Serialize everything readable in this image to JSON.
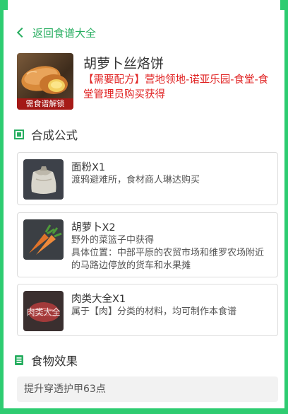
{
  "nav": {
    "back_label": "返回食谱大全"
  },
  "recipe": {
    "title": "胡萝卜丝烙饼",
    "badge": "需食谱解锁",
    "note": "【需要配方】营地领地-诺亚乐园-食堂-食堂管理员购买获得"
  },
  "sections": {
    "formula_title": "合成公式",
    "effect_title": "食物效果"
  },
  "ingredients": [
    {
      "name": "面粉X1",
      "desc": "渡鸦避难所，食材商人琳达购买",
      "icon": "flour-sack-icon"
    },
    {
      "name": "胡萝卜X2",
      "desc": "野外的菜篮子中获得\n具体位置：中部平原的农贸市场和维罗农场附近的马路边停放的货车和水果摊",
      "icon": "carrot-icon"
    },
    {
      "name": "肉类大全X1",
      "desc": "属于【肉】分类的材料，均可制作本食谱",
      "icon": "meat-icon",
      "overlay": "肉类大全"
    }
  ],
  "effect": {
    "text": "提升穿透护甲63点"
  },
  "colors": {
    "accent": "#27ae60",
    "frame": "#2ecc71",
    "warning": "#e02020"
  }
}
